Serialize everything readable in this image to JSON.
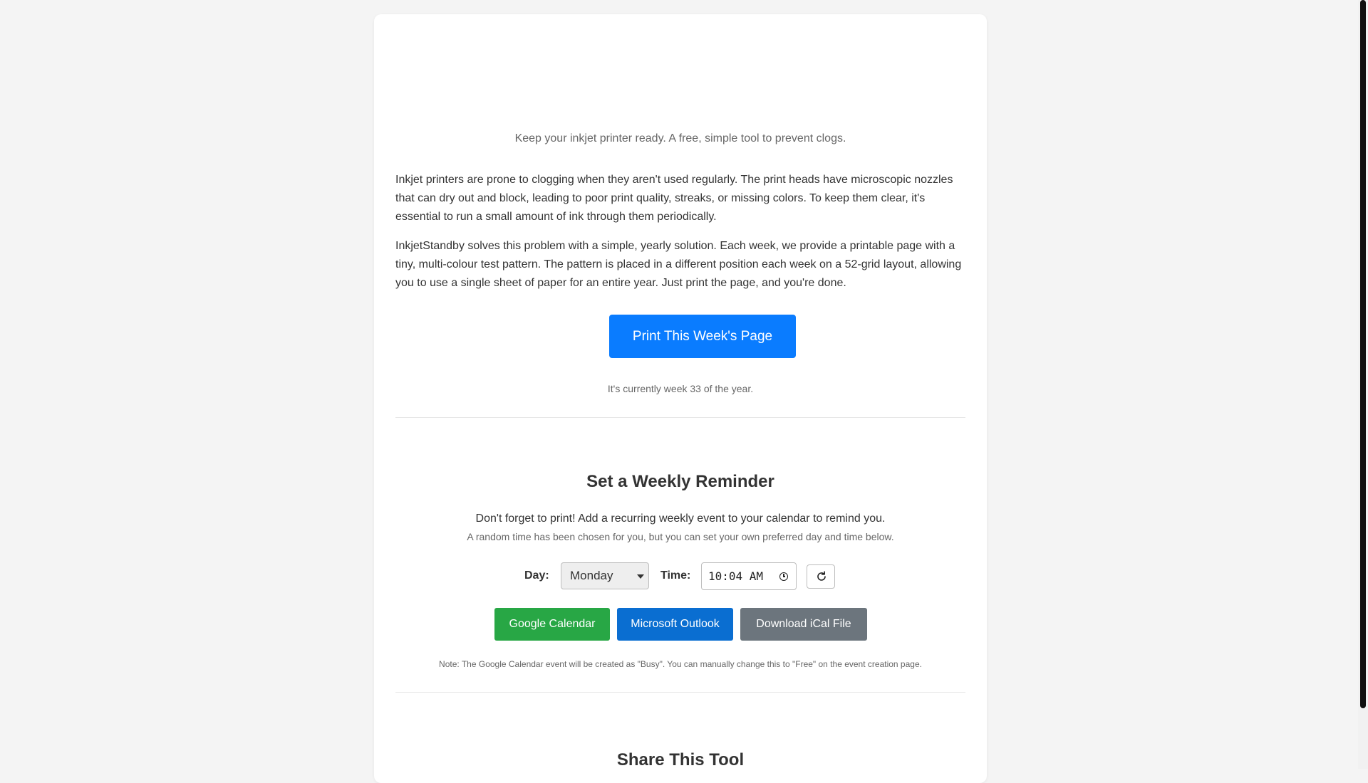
{
  "header": {
    "subtitle": "Keep your inkjet printer ready. A free, simple tool to prevent clogs."
  },
  "intro": {
    "paragraph_1": "Inkjet printers are prone to clogging when they aren't used regularly. The print heads have microscopic nozzles that can dry out and block, leading to poor print quality, streaks, or missing colors. To keep them clear, it's essential to run a small amount of ink through them periodically.",
    "paragraph_2": "InkjetStandby solves this problem with a simple, yearly solution. Each week, we provide a printable page with a tiny, multi-colour test pattern. The pattern is placed in a different position each week on a 52-grid layout, allowing you to use a single sheet of paper for an entire year. Just print the page, and you're done."
  },
  "print": {
    "button_label": "Print This Week's Page",
    "week_note": "It's currently week 33 of the year."
  },
  "reminder": {
    "title": "Set a Weekly Reminder",
    "description": "Don't forget to print! Add a recurring weekly event to your calendar to remind you.",
    "subdescription": "A random time has been chosen for you, but you can set your own preferred day and time below.",
    "day_label": "Day:",
    "day_value": "Monday",
    "time_label": "Time:",
    "time_value": "10:04 AM",
    "buttons": {
      "google": "Google Calendar",
      "outlook": "Microsoft Outlook",
      "ical": "Download iCal File"
    },
    "note": "Note: The Google Calendar event will be created as \"Busy\". You can manually change this to \"Free\" on the event creation page."
  },
  "share": {
    "title": "Share This Tool"
  },
  "colors": {
    "primary": "#0a7cff",
    "google": "#28a745",
    "outlook": "#0a6ed1",
    "ical": "#6c757d",
    "background": "#f4f4f4"
  },
  "icons": {
    "refresh": "refresh-icon",
    "clock": "clock-icon",
    "dropdown": "chevron-down-icon"
  }
}
